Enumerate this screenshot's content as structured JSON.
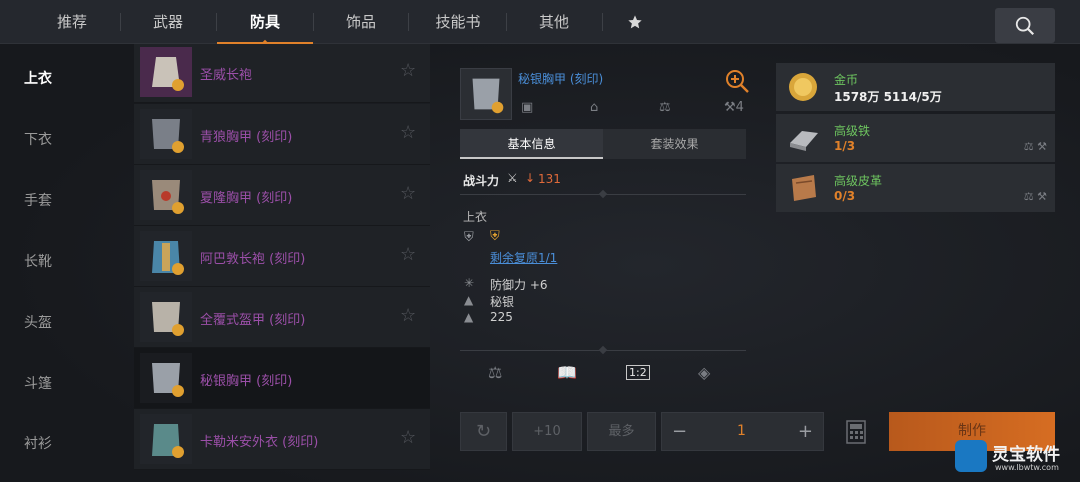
{
  "nav": {
    "tabs": [
      "推荐",
      "武器",
      "防具",
      "饰品",
      "技能书",
      "其他"
    ],
    "active_index": 2,
    "favorites_icon": "star-icon",
    "search_icon": "search-icon"
  },
  "categories": {
    "items": [
      "上衣",
      "下衣",
      "手套",
      "长靴",
      "头盔",
      "斗篷",
      "衬衫"
    ],
    "active": "上衣"
  },
  "item_list": [
    {
      "name": "圣威长袍",
      "color": "#9b4fa8"
    },
    {
      "name": "青狼胸甲 (刻印)",
      "color": "#9b4fa8"
    },
    {
      "name": "夏隆胸甲 (刻印)",
      "color": "#9b4fa8"
    },
    {
      "name": "阿巴敦长袍 (刻印)",
      "color": "#9b4fa8"
    },
    {
      "name": "全覆式盔甲 (刻印)",
      "color": "#9b4fa8"
    },
    {
      "name": "秘银胸甲 (刻印)",
      "color": "#9b4fa8",
      "selected": true
    },
    {
      "name": "卡勒米安外衣 (刻印)",
      "color": "#9b4fa8"
    }
  ],
  "detail": {
    "title": "秘银胸甲 (刻印)",
    "icon_count": "4",
    "tabs": [
      "基本信息",
      "套装效果"
    ],
    "power_label": "战斗力",
    "power_value": "131",
    "slot": "上衣",
    "restore_text": "剩余复原1/1",
    "stats": [
      {
        "icon": "defense-icon",
        "text": "防御力 +6"
      },
      {
        "icon": "material-icon",
        "text": "秘银"
      },
      {
        "icon": "weight-icon",
        "text": "225"
      }
    ]
  },
  "controls": {
    "plus10": "+10",
    "max": "最多",
    "minus": "−",
    "quantity": "1",
    "plus": "+",
    "craft": "制作"
  },
  "materials": [
    {
      "name": "金币",
      "value": "1578万 5114/5万",
      "icon": "gold-coin-icon"
    },
    {
      "name": "高级铁",
      "value": "1/3",
      "icon": "iron-ingot-icon"
    },
    {
      "name": "高级皮革",
      "value": "0/3",
      "icon": "leather-icon"
    }
  ],
  "watermark": {
    "name": "灵宝软件",
    "url": "www.lbwtw.com"
  },
  "colors": {
    "accent": "#e0812a",
    "link": "#4a8ed8",
    "purple": "#9b4fa8",
    "green": "#6dc45f"
  }
}
